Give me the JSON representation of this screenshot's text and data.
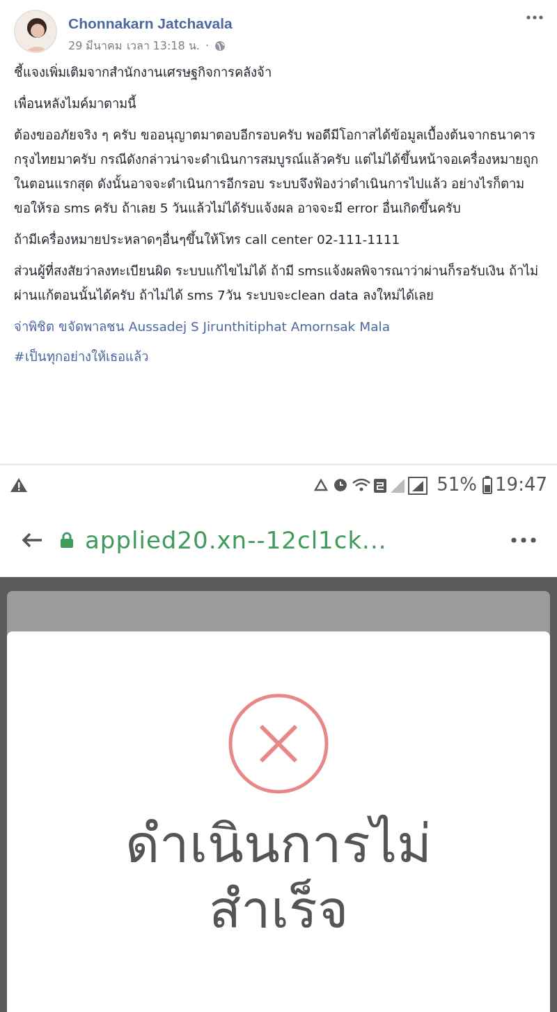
{
  "post": {
    "author": "Chonnakarn Jatchavala",
    "timestamp": "29 มีนาคม เวลา 13:18 น.",
    "separator": "·",
    "paragraphs": [
      "ชี้แจงเพิ่มเติมจากสำนักงานเศรษฐกิจการคลังจ้า",
      "เพื่อนหลังไมค์มาตามนี้",
      "ต้องขออภัยจริง ๆ ครับ ขออนุญาตมาตอบอีกรอบครับ พอดีมีโอกาสได้ข้อมูลเบื้องต้นจากธนาคารกรุงไทยมาครับ กรณีดังกล่าวน่าจะดำเนินการสมบูรณ์แล้วครับ แต่ไม่ได้ขึ้นหน้าจอเครื่องหมายถูกในตอนแรกสุด ดังนั้นอาจจะดำเนินการอีกรอบ ระบบจึงฟ้องว่าดำเนินการไปแล้ว อย่างไรก็ตาม ขอให้รอ sms ครับ ถ้าเลย 5 วันแล้วไม่ได้รับแจ้งผล อาจจะมี error อื่นเกิดขึ้นครับ",
      "ถ้ามีเครื่องหมายประหลาดๆอื่นๆขึ้นให้โทร call center 02-111-1111",
      "ส่วนผู้ที่สงสัยว่าลงทะเบียนผิด ระบบแก้ไขไม่ได้ ถ้ามี smsแจ้งผลพิจารณาว่าผ่านก็รอรับเงิน ถ้าไม่ผ่านแก้ตอนนั้นได้ครับ ถ้าไม่ได้ sms 7วัน ระบบจะclean data ลงใหม่ได้เลย"
    ],
    "tags": "จ่าพิชิต ขจัดพาลชน Aussadej S Jirunthitiphat Amornsak Mala",
    "hashtag": "#เป็นทุกอย่างให้เธอแล้ว"
  },
  "phone": {
    "status_bar": {
      "battery": "51%",
      "time": "19:47"
    },
    "browser": {
      "url": "applied20.xn--12cl1ck..."
    },
    "dialog": {
      "message_lines": [
        "ดำเนินการไม่",
        "สำเร็จ"
      ]
    }
  }
}
